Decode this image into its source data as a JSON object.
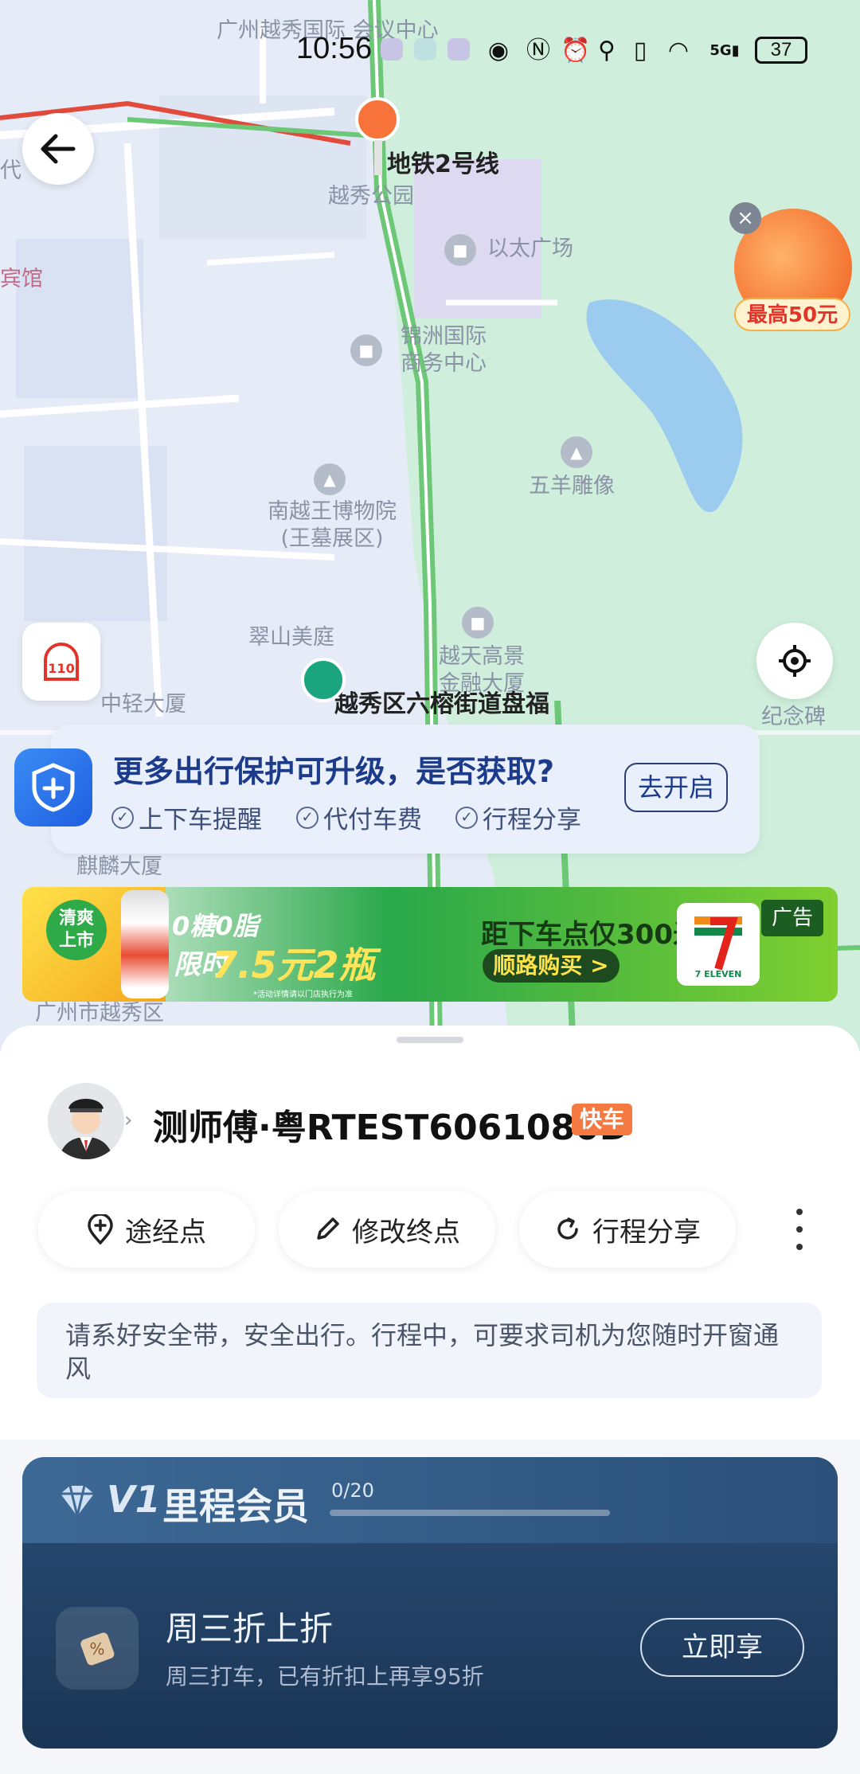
{
  "status_bar": {
    "time": "10:56",
    "network": "5G",
    "battery": "37"
  },
  "map": {
    "labels": {
      "conference": "广州越秀国际\n会议中心",
      "metro_station": "地铁2号线",
      "yuexiu_park": "越秀公园",
      "yitai": "以太广场",
      "jinzhou": "锦洲国际\n商务中心",
      "wuyang": "五羊雕像",
      "museum": "南越王博物院\n(王墓展区)",
      "cuishan": "翠山美庭",
      "yuetian": "越天高景\n金融大厦",
      "zhongqing": "中轻大厦",
      "start_point": "越秀区六榕街道盘福",
      "memorial": "纪念碑",
      "qilin": "麒麟大厦",
      "district": "广州市越秀区",
      "hotel": "宾馆",
      "left_edge": "代"
    },
    "promo_tag": "最高50元",
    "police_label": "110"
  },
  "protection_banner": {
    "title": "更多出行保护可升级，是否获取?",
    "options": [
      "上下车提醒",
      "代付车费",
      "行程分享"
    ],
    "button": "去开启"
  },
  "ad": {
    "badge": "清爽\n上市",
    "line1": "0糖0脂",
    "line2_prefix": "限时",
    "line2": "7.5元2瓶",
    "fine_print": "*活动详情请以门店执行为准",
    "distance": "距下车点仅300米",
    "buy": "顺路购买 >",
    "tag": "广告",
    "logo_text": "7 ELEVEN"
  },
  "driver": {
    "name": "测师傅·粤RTEST6061080D",
    "car_type": "快车"
  },
  "actions": [
    {
      "label": "途经点",
      "icon": "waypoint-icon"
    },
    {
      "label": "修改终点",
      "icon": "edit-icon"
    },
    {
      "label": "行程分享",
      "icon": "share-icon"
    }
  ],
  "safety_tip": "请系好安全带，安全出行。行程中，可要求司机为您随时开窗通风",
  "member": {
    "level": "V1",
    "title": "里程会员",
    "progress_text": "0/20",
    "progress_fraction": 0,
    "benefit_title": "周三折上折",
    "benefit_desc": "周三打车，已有折扣上再享95折",
    "benefit_button": "立即享"
  },
  "colors": {
    "map_bg": "#e6ecf7",
    "park": "#cfeedc",
    "road_green": "#6cc777",
    "brand_orange": "#f57a42",
    "member_bg": "#1a3555"
  }
}
